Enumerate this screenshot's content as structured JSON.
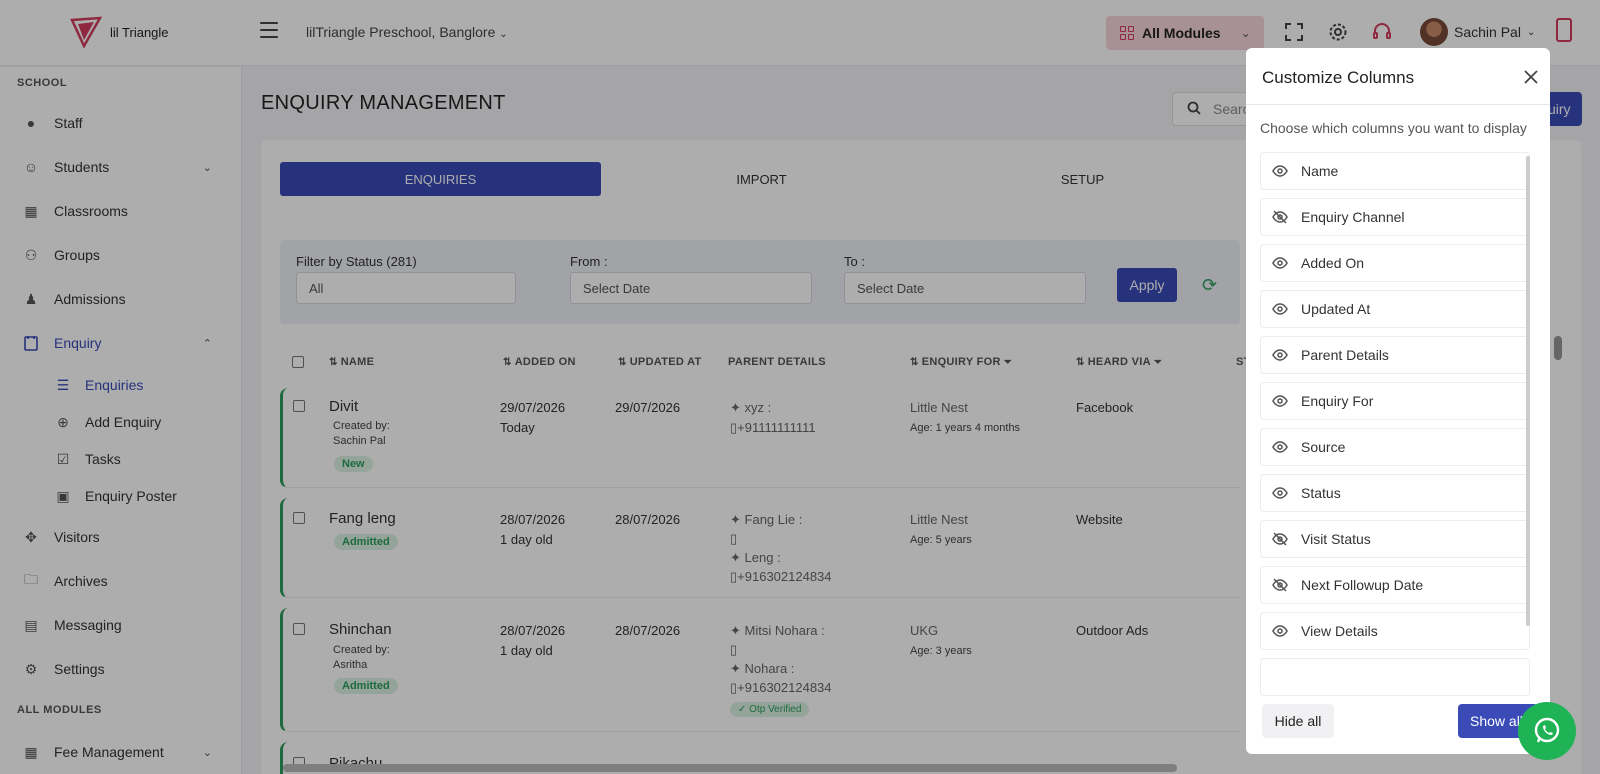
{
  "header": {
    "brand": "lil Triangle",
    "school": "lilTriangle Preschool, Banglore",
    "modules_label": "All Modules",
    "user_name": "Sachin Pal"
  },
  "colors": {
    "primary": "#3a4bb8",
    "brand_pink": "#d23d5e",
    "success": "#2a9d5c"
  },
  "sidebar": {
    "section_school": "SCHOOL",
    "items": [
      {
        "label": "Staff",
        "icon": "staff-icon"
      },
      {
        "label": "Students",
        "icon": "students-icon"
      },
      {
        "label": "Classrooms",
        "icon": "classrooms-icon"
      },
      {
        "label": "Groups",
        "icon": "groups-icon"
      },
      {
        "label": "Admissions",
        "icon": "admissions-icon"
      },
      {
        "label": "Enquiry",
        "icon": "enquiry-icon"
      }
    ],
    "sub_items": [
      {
        "label": "Enquiries",
        "icon": "list-icon"
      },
      {
        "label": "Add Enquiry",
        "icon": "plus-circle-icon"
      },
      {
        "label": "Tasks",
        "icon": "tasks-icon"
      },
      {
        "label": "Enquiry Poster",
        "icon": "image-icon"
      }
    ],
    "items2": [
      {
        "label": "Visitors",
        "icon": "visitors-icon"
      },
      {
        "label": "Archives",
        "icon": "folder-icon"
      },
      {
        "label": "Messaging",
        "icon": "messaging-icon"
      },
      {
        "label": "Settings",
        "icon": "settings-icon"
      }
    ],
    "section_all": "ALL MODULES",
    "fee_label": "Fee Management"
  },
  "main": {
    "title": "ENQUIRY MANAGEMENT",
    "search_placeholder": "Searc",
    "add_button": "uiry",
    "tabs": [
      "ENQUIRIES",
      "IMPORT",
      "SETUP"
    ],
    "filter": {
      "status_label": "Filter by Status (281)",
      "status_value": "All",
      "from_label": "From :",
      "from_placeholder": "Select Date",
      "to_label": "To :",
      "to_placeholder": "Select Date",
      "apply": "Apply"
    },
    "columns": [
      "NAME",
      "ADDED ON",
      "UPDATED AT",
      "PARENT DETAILS",
      "ENQUIRY FOR",
      "HEARD VIA",
      "ST"
    ],
    "rows": [
      {
        "name": "Divit",
        "created_by_label": "Created by:",
        "created_by": "Sachin Pal",
        "badge": "New",
        "added": "29/07/2026",
        "added_rel": "Today",
        "updated": "29/07/2026",
        "parent1": "xyz :",
        "phone1": "+91111111111",
        "enquiry_for": "Little Nest",
        "age": "Age: 1 years 4 months",
        "heard_via": "Facebook"
      },
      {
        "name": "Fang leng",
        "badge": "Admitted",
        "added": "28/07/2026",
        "added_rel": "1 day old",
        "updated": "28/07/2026",
        "parent1": "Fang Lie :",
        "phone1": "",
        "parent2": "Leng :",
        "phone2": "+916302124834",
        "enquiry_for": "Little Nest",
        "age": "Age: 5 years",
        "heard_via": "Website"
      },
      {
        "name": "Shinchan",
        "created_by_label": "Created by:",
        "created_by": "Asritha",
        "badge": "Admitted",
        "added": "28/07/2026",
        "added_rel": "1 day old",
        "updated": "28/07/2026",
        "parent1": "Mitsi Nohara :",
        "phone1": "",
        "parent2": "Nohara :",
        "phone2": "+916302124834",
        "otp": "Otp Verified",
        "enquiry_for": "UKG",
        "age": "Age: 3 years",
        "heard_via": "Outdoor Ads"
      },
      {
        "name": "Pikachu"
      }
    ]
  },
  "modal": {
    "title": "Customize Columns",
    "subtitle": "Choose which columns you want to display",
    "columns": [
      {
        "label": "Name",
        "visible": true
      },
      {
        "label": "Enquiry Channel",
        "visible": false
      },
      {
        "label": "Added On",
        "visible": true
      },
      {
        "label": "Updated At",
        "visible": true
      },
      {
        "label": "Parent Details",
        "visible": true
      },
      {
        "label": "Enquiry For",
        "visible": true
      },
      {
        "label": "Source",
        "visible": true
      },
      {
        "label": "Status",
        "visible": true
      },
      {
        "label": "Visit Status",
        "visible": false
      },
      {
        "label": "Next Followup Date",
        "visible": false
      },
      {
        "label": "View Details",
        "visible": true
      }
    ],
    "hide_all": "Hide all",
    "show_all": "Show all"
  }
}
